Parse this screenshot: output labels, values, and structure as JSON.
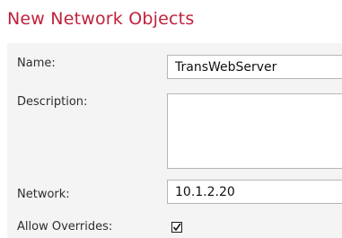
{
  "header": {
    "title": "New Network Objects",
    "title_color": "#c0213a"
  },
  "form": {
    "name_label": "Name:",
    "name_value": "TransWebServer",
    "description_label": "Description:",
    "description_value": "",
    "network_label": "Network:",
    "network_value": "10.1.2.20",
    "allow_overrides_label": "Allow Overrides:",
    "allow_overrides_checked": true,
    "check_icon": "checkmark-icon"
  }
}
